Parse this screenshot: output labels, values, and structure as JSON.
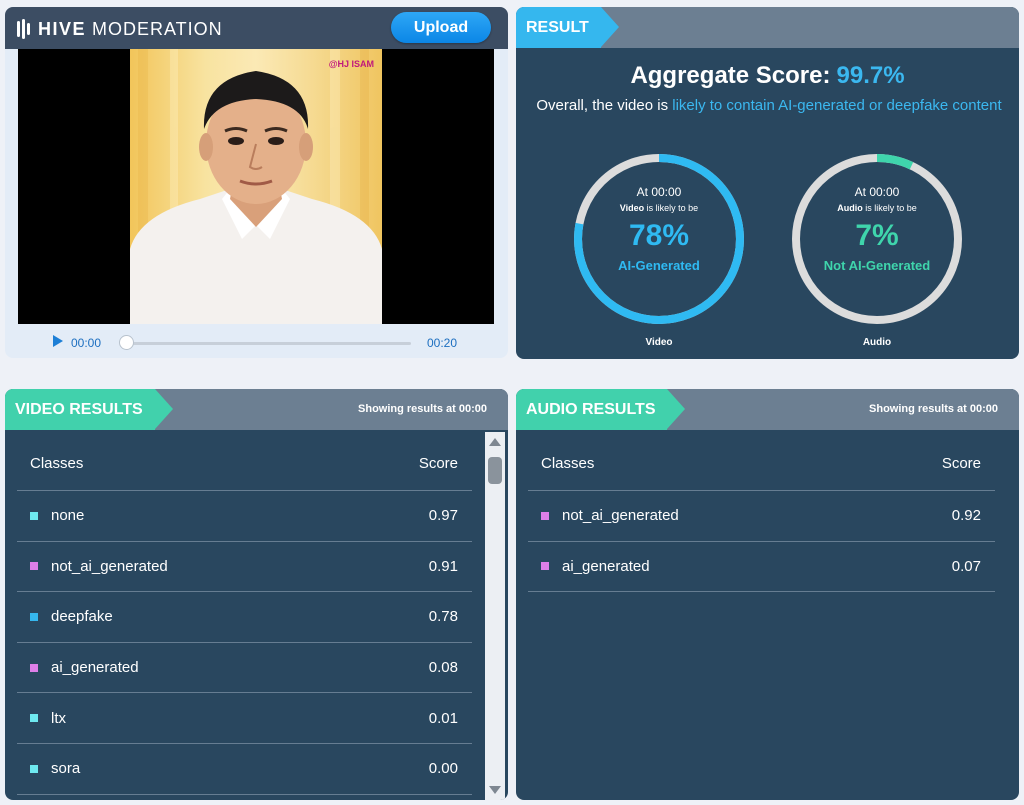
{
  "header": {
    "brand_strong": "HIVE",
    "brand_light": "MODERATION",
    "upload_label": "Upload"
  },
  "player": {
    "watermark": "@HJ ISAM",
    "current_time": "00:00",
    "duration": "00:20",
    "progress_fraction": 0.0
  },
  "result": {
    "tag": "RESULT",
    "aggregate_label": "Aggregate Score:",
    "aggregate_value": "99.7%",
    "verdict_prefix": "Overall, the video is",
    "verdict_highlight": "likely to contain AI-generated or deepfake content",
    "gauges": [
      {
        "at": "At 00:00",
        "subject": "Video",
        "likely_text": "is likely to be",
        "percent": "78%",
        "value": 0.78,
        "classification": "AI-Generated",
        "caption": "Video",
        "color": "#2fbaf2"
      },
      {
        "at": "At 00:00",
        "subject": "Audio",
        "likely_text": "is likely to be",
        "percent": "7%",
        "value": 0.07,
        "classification": "Not AI-Generated",
        "caption": "Audio",
        "color": "#3fd5ac"
      }
    ]
  },
  "video_results": {
    "tag": "VIDEO RESULTS",
    "showing": "Showing results at 00:00",
    "col_classes": "Classes",
    "col_score": "Score",
    "rows": [
      {
        "label": "none",
        "score": "0.97",
        "color": "#6ee9f0"
      },
      {
        "label": "not_ai_generated",
        "score": "0.91",
        "color": "#dd7fe8"
      },
      {
        "label": "deepfake",
        "score": "0.78",
        "color": "#35b7ee"
      },
      {
        "label": "ai_generated",
        "score": "0.08",
        "color": "#dd7fe8"
      },
      {
        "label": "ltx",
        "score": "0.01",
        "color": "#6ee9f0"
      },
      {
        "label": "sora",
        "score": "0.00",
        "color": "#6ee9f0"
      }
    ]
  },
  "audio_results": {
    "tag": "AUDIO RESULTS",
    "showing": "Showing results at 00:00",
    "col_classes": "Classes",
    "col_score": "Score",
    "rows": [
      {
        "label": "not_ai_generated",
        "score": "0.92",
        "color": "#dd7fe8"
      },
      {
        "label": "ai_generated",
        "score": "0.07",
        "color": "#dd7fe8"
      }
    ]
  },
  "colors": {
    "panel_dark": "#29475f",
    "header_slate": "#6c7f92",
    "accent_blue": "#35b7ee",
    "accent_green": "#41d1ac",
    "gauge_track": "#dcdcdc"
  }
}
